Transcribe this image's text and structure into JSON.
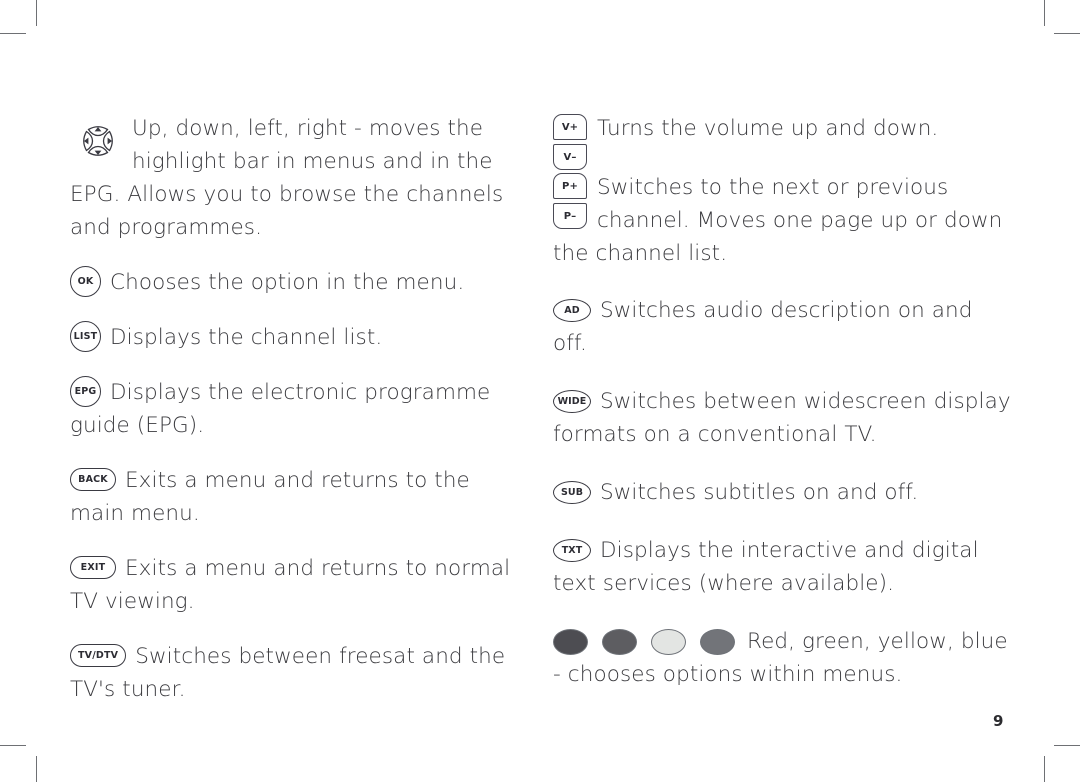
{
  "page": {
    "number": "9",
    "background": "#ffffff",
    "text_color": "#3a3a3e",
    "crop_mark_color": "#6e7074"
  },
  "left_column": {
    "entries": [
      {
        "icon": "dpad-navigation-icon",
        "icon_type": "dpad",
        "icon_label": "",
        "text": "Up, down, left, right - moves the highlight bar in menus and in the EPG. Allows you to browse the channels and programmes."
      },
      {
        "icon": "ok-button-icon",
        "icon_type": "circle",
        "icon_label": "OK",
        "text": "Chooses the option in the menu."
      },
      {
        "icon": "list-button-icon",
        "icon_type": "circle",
        "icon_label": "LIST",
        "text": "Displays the channel list."
      },
      {
        "icon": "epg-button-icon",
        "icon_type": "circle",
        "icon_label": "EPG",
        "text": "Displays the electronic programme guide (EPG)."
      },
      {
        "icon": "back-button-icon",
        "icon_type": "pill",
        "icon_label": "BACK",
        "text": "Exits a menu and returns to the main menu."
      },
      {
        "icon": "exit-button-icon",
        "icon_type": "pill",
        "icon_label": "EXIT",
        "text": "Exits a menu and returns to normal TV viewing."
      },
      {
        "icon": "tv-dtv-button-icon",
        "icon_type": "pill",
        "icon_label": "TV/DTV",
        "text": "Switches between freesat and the TV's tuner."
      }
    ]
  },
  "right_column": {
    "entries": [
      {
        "icon": "volume-rocker-icon",
        "icon_type": "rocker",
        "icon_label_up": "V+",
        "icon_label_down": "V–",
        "text": "Turns the volume up and down."
      },
      {
        "icon": "programme-rocker-icon",
        "icon_type": "rocker",
        "icon_label_up": "P+",
        "icon_label_down": "P–",
        "text": "Switches to the next or previous channel. Moves one page up or down the channel list."
      },
      {
        "icon": "ad-button-icon",
        "icon_type": "ellipse",
        "icon_label": "AD",
        "text": "Switches audio description on and off."
      },
      {
        "icon": "wide-button-icon",
        "icon_type": "ellipse",
        "icon_label": "WIDE",
        "text": "Switches between widescreen display formats on a conventional TV."
      },
      {
        "icon": "sub-button-icon",
        "icon_type": "ellipse",
        "icon_label": "SUB",
        "text": "Switches subtitles on and off."
      },
      {
        "icon": "txt-button-icon",
        "icon_type": "ellipse",
        "icon_label": "TXT",
        "text": "Displays the interactive and digital text services (where available)."
      },
      {
        "icon": "colour-buttons-icon",
        "icon_type": "dots",
        "dots": [
          {
            "name": "red-colour-button",
            "color": "#4d4d52"
          },
          {
            "name": "green-colour-button",
            "color": "#5d5d61"
          },
          {
            "name": "yellow-colour-button",
            "color": "#e3e5e3"
          },
          {
            "name": "blue-colour-button",
            "color": "#727479"
          }
        ],
        "text": "Red, green, yellow, blue - chooses options within menus."
      }
    ]
  }
}
